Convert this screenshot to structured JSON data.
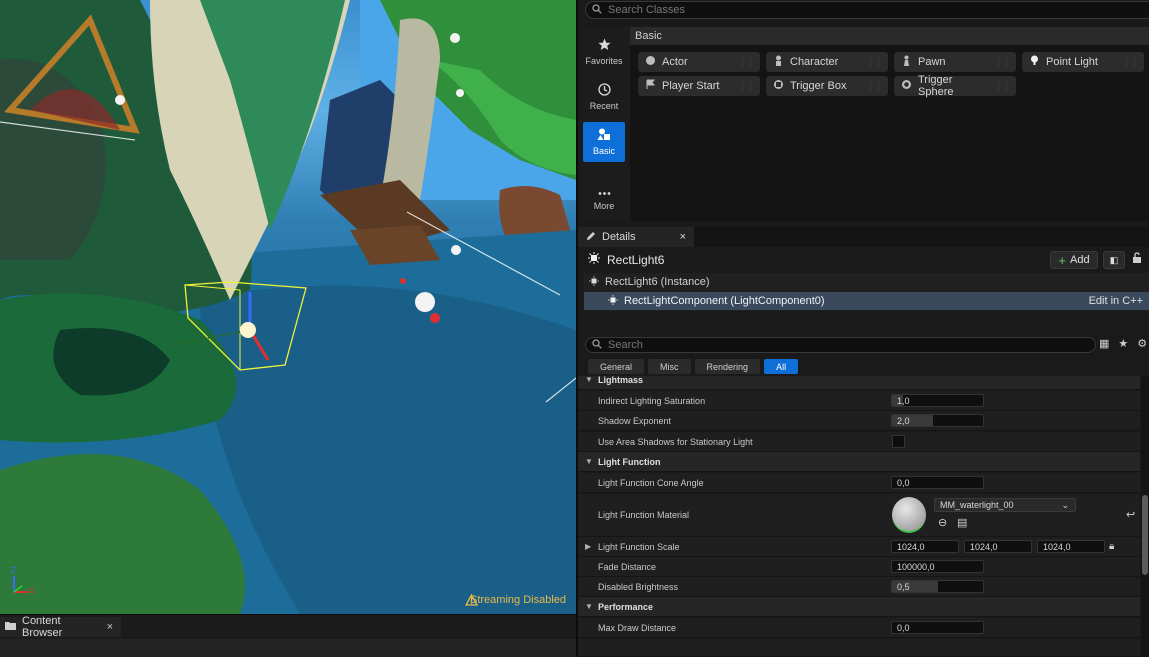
{
  "viewport": {
    "status_text": "Streaming Disabled",
    "axis_x": "X",
    "axis_z": "Z"
  },
  "content_browser": {
    "tab_label": "Content Browser",
    "close_glyph": "×"
  },
  "place_actors": {
    "search_placeholder": "Search Classes",
    "sidebar": [
      {
        "label": "Favorites",
        "icon": "star-icon"
      },
      {
        "label": "Recent",
        "icon": "clock-icon"
      },
      {
        "label": "Basic",
        "icon": "shapes-icon",
        "active": true
      },
      {
        "label": "More",
        "icon": "ellipsis-icon"
      }
    ],
    "section_header": "Basic",
    "classes": [
      {
        "label": "Actor",
        "icon": "actor-icon"
      },
      {
        "label": "Character",
        "icon": "character-icon"
      },
      {
        "label": "Pawn",
        "icon": "pawn-icon"
      },
      {
        "label": "Point Light",
        "icon": "point-light-icon"
      },
      {
        "label": "Player Start",
        "icon": "player-start-icon"
      },
      {
        "label": "Trigger Box",
        "icon": "trigger-box-icon"
      },
      {
        "label": "Trigger Sphere",
        "icon": "trigger-sphere-icon"
      }
    ]
  },
  "details": {
    "tab_label": "Details",
    "close_glyph": "×",
    "object_name": "RectLight6",
    "add_label": "Add",
    "instance_label": "RectLight6 (Instance)",
    "component_label": "RectLightComponent (LightComponent0)",
    "edit_cpp_label": "Edit in C++",
    "search_placeholder": "Search",
    "filters": [
      {
        "label": "General"
      },
      {
        "label": "Misc"
      },
      {
        "label": "Rendering"
      },
      {
        "label": "All",
        "active": true
      }
    ],
    "properties": {
      "lightmass_cat": "Lightmass",
      "indirect_label": "Indirect Lighting Saturation",
      "indirect_value": "1,0",
      "indirect_fill": 0.12,
      "shadow_exp_label": "Shadow Exponent",
      "shadow_exp_value": "2,0",
      "shadow_exp_fill": 0.45,
      "area_shadows_label": "Use Area Shadows for Stationary Light",
      "area_shadows_checked": false,
      "light_function_cat": "Light Function",
      "cone_angle_label": "Light Function Cone Angle",
      "cone_angle_value": "0,0",
      "material_label": "Light Function Material",
      "material_value": "MM_waterlight_00",
      "scale_label": "Light Function Scale",
      "scale_x": "1024,0",
      "scale_y": "1024,0",
      "scale_z": "1024,0",
      "fade_label": "Fade Distance",
      "fade_value": "100000,0",
      "disabled_bright_label": "Disabled Brightness",
      "disabled_bright_value": "0,5",
      "disabled_bright_fill": 0.5,
      "performance_cat": "Performance",
      "max_draw_label": "Max Draw Distance",
      "max_draw_value": "0,0"
    }
  },
  "colors": {
    "accent": "#0e6fd8",
    "warning": "#e8b94a",
    "selection": "#3a4a5c"
  }
}
